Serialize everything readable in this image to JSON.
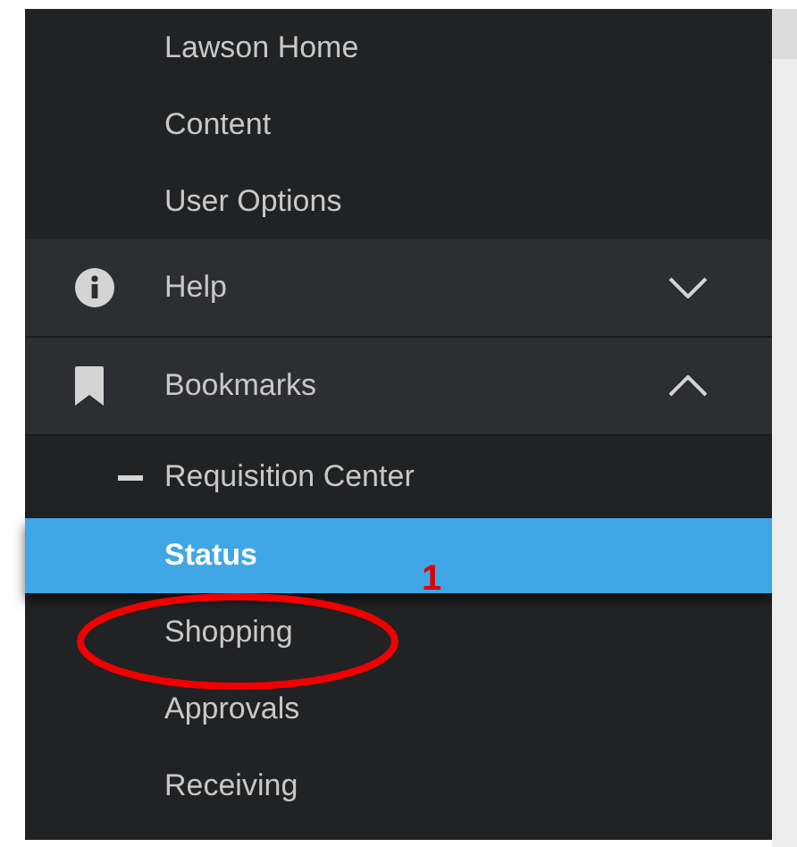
{
  "sidebar": {
    "top_items": [
      {
        "label": "Lawson Home"
      },
      {
        "label": "Content"
      },
      {
        "label": "User Options"
      }
    ],
    "sections": [
      {
        "label": "Help",
        "kind": "info",
        "expanded": false
      },
      {
        "label": "Bookmarks",
        "kind": "bookmark",
        "expanded": true,
        "group": {
          "label": "Requisition Center",
          "expanded": true,
          "children": [
            {
              "label": "Status",
              "selected": true
            },
            {
              "label": "Shopping",
              "selected": false
            },
            {
              "label": "Approvals",
              "selected": false
            },
            {
              "label": "Receiving",
              "selected": false
            }
          ]
        }
      }
    ]
  },
  "annotation": {
    "label": "1"
  }
}
